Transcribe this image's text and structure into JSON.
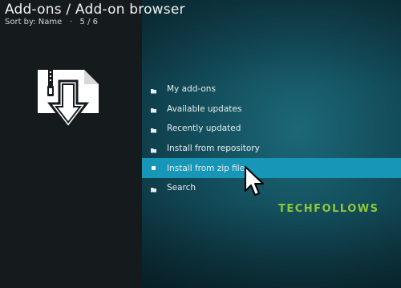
{
  "header": {
    "title": "Add-ons / Add-on browser",
    "sort_label": "Sort by: Name",
    "separator": "·",
    "page_info": "5 / 6"
  },
  "addon_icon": "zip-download-icon",
  "menu": {
    "items": [
      {
        "label": "My add-ons",
        "icon": "folder-icon"
      },
      {
        "label": "Available updates",
        "icon": "folder-icon"
      },
      {
        "label": "Recently updated",
        "icon": "folder-icon"
      },
      {
        "label": "Install from repository",
        "icon": "folder-icon"
      },
      {
        "label": "Install from zip file",
        "icon": "selected-bullet-icon"
      },
      {
        "label": "Search",
        "icon": "folder-icon"
      }
    ],
    "selected_index": 4
  },
  "watermark": "TECHFOLLOWS",
  "colors": {
    "selected_bg": "#1796b8",
    "left_pane": "#151a1d",
    "watermark": "#8ec93a"
  }
}
